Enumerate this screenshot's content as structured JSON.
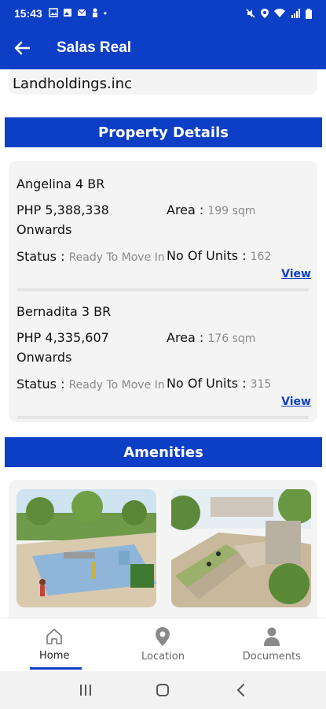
{
  "status_bar": {
    "time": "15:43"
  },
  "app_bar": {
    "title": "Salas Real"
  },
  "developer": {
    "name": "Landholdings.inc"
  },
  "property_section": {
    "title": "Property Details"
  },
  "units": [
    {
      "name": "Angelina  4 BR",
      "price": "PHP  5,388,338 Onwards",
      "area_label": "Area :",
      "area_value": "199 sqm",
      "status_label": "Status :",
      "status_value": "Ready To Move In",
      "units_label": "No Of Units :",
      "units_value": "162",
      "view_label": "View"
    },
    {
      "name": "Bernadita  3 BR",
      "price": "PHP  4,335,607 Onwards",
      "area_label": "Area :",
      "area_value": "176 sqm",
      "status_label": "Status :",
      "status_value": "Ready To Move In",
      "units_label": "No Of Units :",
      "units_value": "315",
      "view_label": "View"
    }
  ],
  "amenities_section": {
    "title": "Amenities"
  },
  "bottom_nav": {
    "items": [
      {
        "label": "Home",
        "icon": "home-icon"
      },
      {
        "label": "Location",
        "icon": "location-pin-icon"
      },
      {
        "label": "Documents",
        "icon": "person-icon"
      }
    ],
    "active": "Home"
  },
  "colors": {
    "primary": "#0d3fc6",
    "card": "#f4f4f4",
    "link": "#0d3fc6"
  }
}
